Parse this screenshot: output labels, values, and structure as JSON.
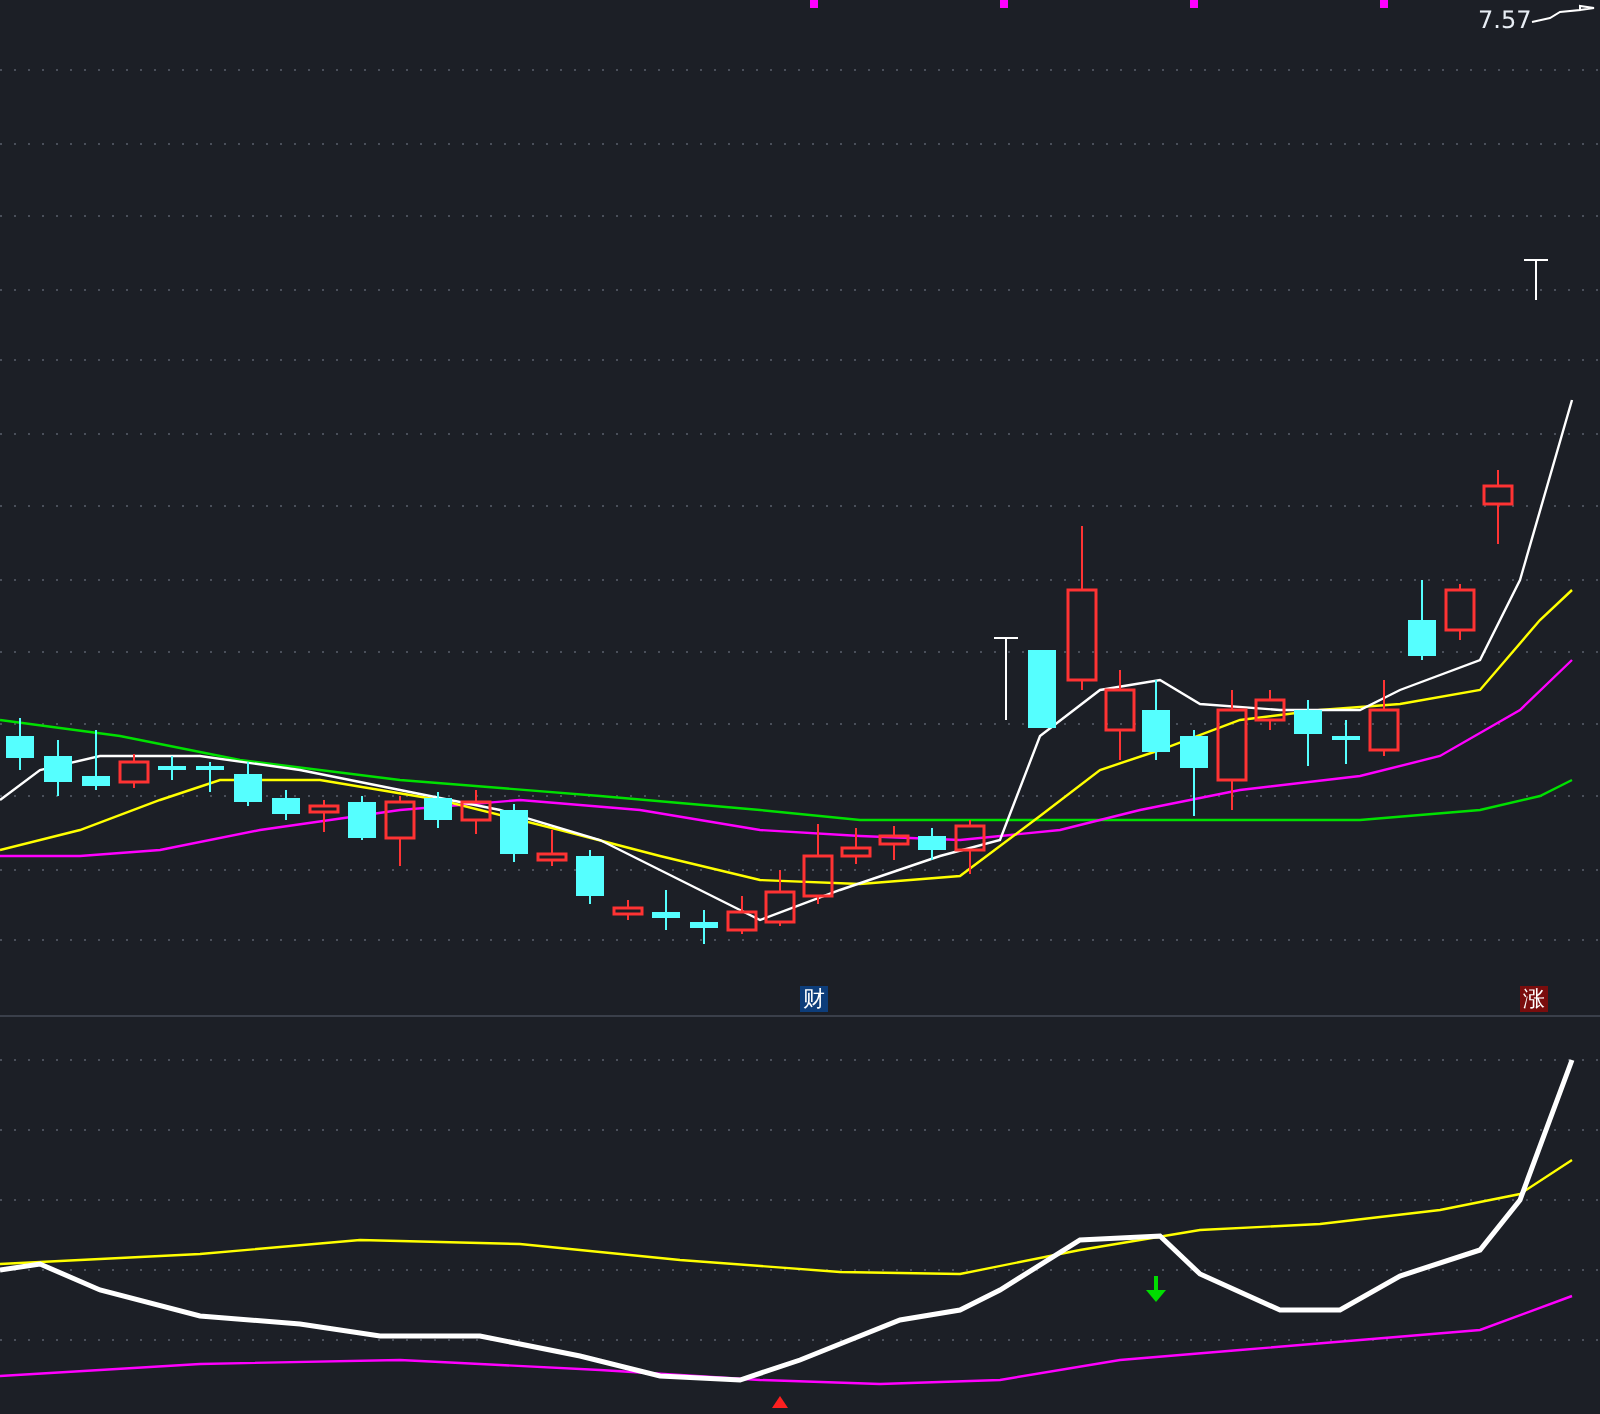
{
  "price_label": "7.57",
  "markers": [
    {
      "text": "财",
      "kind": "finance"
    },
    {
      "text": "涨",
      "kind": "rise"
    }
  ]
}
